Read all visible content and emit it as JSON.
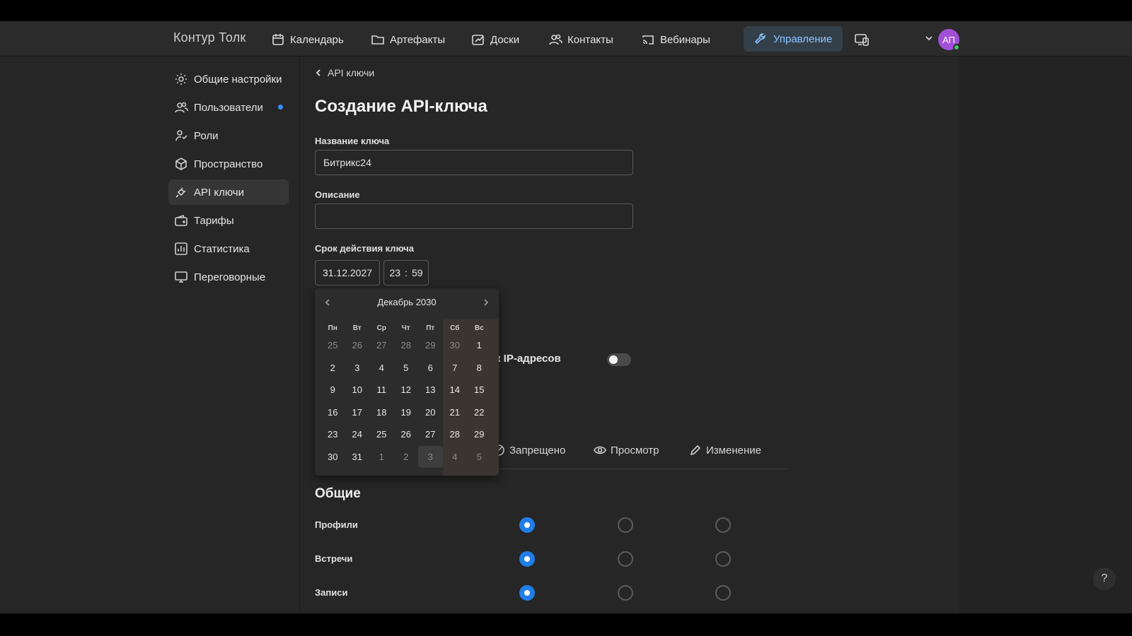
{
  "app": {
    "brand": "Контур Толк"
  },
  "topnav": {
    "items": [
      {
        "label": "Календарь",
        "icon": "calendar-icon"
      },
      {
        "label": "Артефакты",
        "icon": "folder-icon"
      },
      {
        "label": "Доски",
        "icon": "board-icon"
      },
      {
        "label": "Контакты",
        "icon": "contacts-icon"
      },
      {
        "label": "Вебинары",
        "icon": "cast-icon"
      }
    ],
    "active": {
      "label": "Управление",
      "icon": "wrench-icon"
    },
    "avatar_initials": "АП"
  },
  "sidebar": {
    "items": [
      {
        "label": "Общие настройки",
        "icon": "gear-icon"
      },
      {
        "label": "Пользователи",
        "icon": "users-icon",
        "badge": true
      },
      {
        "label": "Роли",
        "icon": "roles-icon"
      },
      {
        "label": "Пространство",
        "icon": "cube-icon"
      },
      {
        "label": "API ключи",
        "icon": "plug-icon",
        "active": true
      },
      {
        "label": "Тарифы",
        "icon": "wallet-icon"
      },
      {
        "label": "Статистика",
        "icon": "chart-icon"
      },
      {
        "label": "Переговорные",
        "icon": "room-icon"
      }
    ]
  },
  "page": {
    "breadcrumb": "API ключи",
    "title": "Создание API-ключа",
    "key_name_label": "Название ключа",
    "key_name_value": "Битрикс24",
    "description_label": "Описание",
    "description_value": "",
    "expiry_label": "Срок действия ключа",
    "expiry_date": "31.12.2027",
    "expiry_hour": "23",
    "expiry_sep": ":",
    "expiry_minute": "59",
    "ip_label_visible": "к IP-адресов",
    "ip_toggle_on": false
  },
  "calendar": {
    "month_title": "Декабрь 2030",
    "weekdays": [
      "Пн",
      "Вт",
      "Ср",
      "Чт",
      "Пт",
      "Сб",
      "Вс"
    ],
    "weeks": [
      [
        {
          "d": "25",
          "m": true
        },
        {
          "d": "26",
          "m": true
        },
        {
          "d": "27",
          "m": true
        },
        {
          "d": "28",
          "m": true
        },
        {
          "d": "29",
          "m": true
        },
        {
          "d": "30",
          "m": true
        },
        {
          "d": "1"
        }
      ],
      [
        {
          "d": "2"
        },
        {
          "d": "3"
        },
        {
          "d": "4"
        },
        {
          "d": "5"
        },
        {
          "d": "6"
        },
        {
          "d": "7"
        },
        {
          "d": "8"
        }
      ],
      [
        {
          "d": "9"
        },
        {
          "d": "10"
        },
        {
          "d": "11"
        },
        {
          "d": "12"
        },
        {
          "d": "13"
        },
        {
          "d": "14"
        },
        {
          "d": "15"
        }
      ],
      [
        {
          "d": "16"
        },
        {
          "d": "17"
        },
        {
          "d": "18"
        },
        {
          "d": "19"
        },
        {
          "d": "20"
        },
        {
          "d": "21"
        },
        {
          "d": "22"
        }
      ],
      [
        {
          "d": "23"
        },
        {
          "d": "24"
        },
        {
          "d": "25"
        },
        {
          "d": "26"
        },
        {
          "d": "27"
        },
        {
          "d": "28"
        },
        {
          "d": "29"
        }
      ],
      [
        {
          "d": "30"
        },
        {
          "d": "31"
        },
        {
          "d": "1",
          "m": true
        },
        {
          "d": "2",
          "m": true
        },
        {
          "d": "3",
          "m": true,
          "hover": true
        },
        {
          "d": "4",
          "m": true
        },
        {
          "d": "5",
          "m": true
        }
      ]
    ]
  },
  "permissions": {
    "columns": [
      {
        "label": "Запрещено",
        "icon": "forbidden-icon"
      },
      {
        "label": "Просмотр",
        "icon": "eye-icon"
      },
      {
        "label": "Изменение",
        "icon": "pencil-icon"
      }
    ],
    "section": "Общие",
    "rows": [
      {
        "label": "Профили",
        "selected": 0
      },
      {
        "label": "Встречи",
        "selected": 0
      },
      {
        "label": "Записи",
        "selected": 0
      }
    ]
  },
  "help_label": "?",
  "colors": {
    "accent": "#1f7ee8",
    "active_nav": "#8fc3ff",
    "avatar": "#a24fd8",
    "online": "#3fc46a"
  }
}
